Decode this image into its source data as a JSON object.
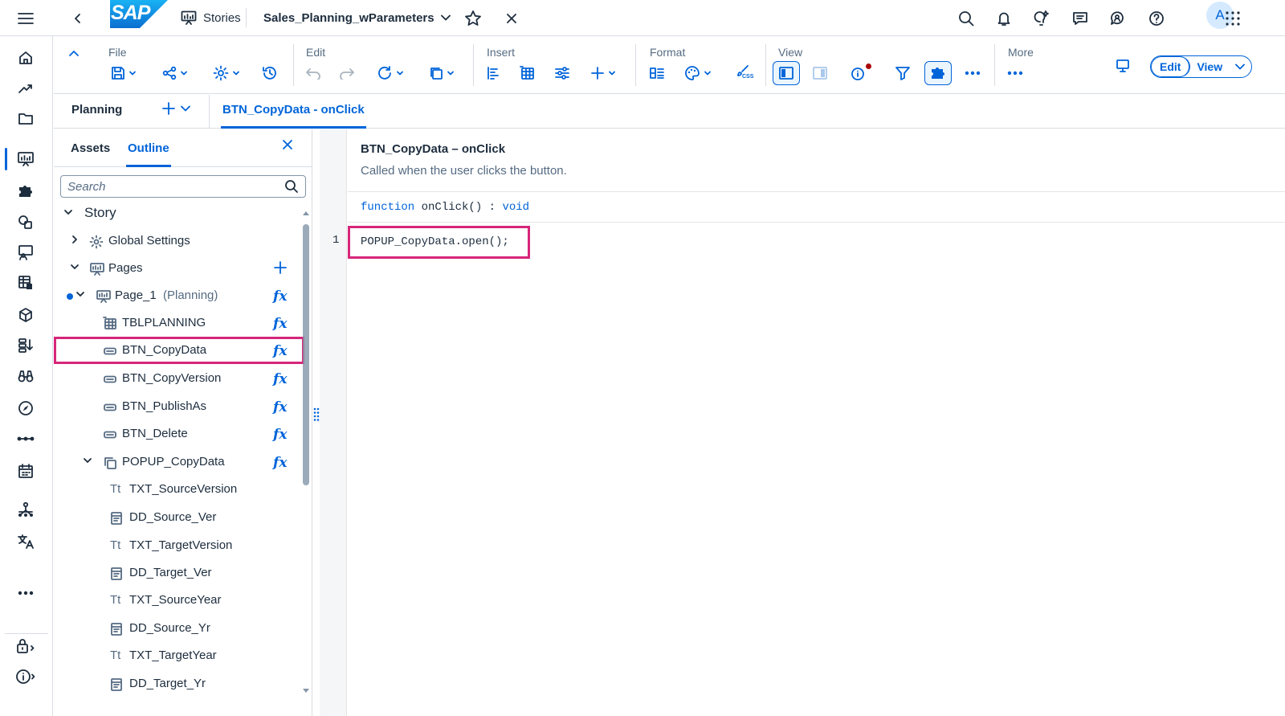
{
  "shell": {
    "logo_text": "SAP",
    "stories_label": "Stories",
    "story_title": "Sales_Planning_wParameters",
    "avatar_initial": "A",
    "accent_color": "#0064d9"
  },
  "left_nav": {
    "items": [
      "home-icon",
      "trend-icon",
      "folder-icon",
      "stories-icon",
      "plugin-icon",
      "analytic-app-icon",
      "presentation-icon",
      "dataset-icon",
      "model-cube-icon",
      "data-action-icon",
      "binoculars-icon",
      "compass-icon",
      "connector-icon",
      "calendar-icon",
      "hierarchy-icon",
      "translation-icon",
      "more-icon",
      "security-icon",
      "info-icon"
    ]
  },
  "toolbar": {
    "file_label": "File",
    "edit_label": "Edit",
    "insert_label": "Insert",
    "format_label": "Format",
    "view_label": "View",
    "more_label": "More",
    "edit_mode_label": "Edit",
    "view_mode_label": "View",
    "css_label": "CSS"
  },
  "tabs": {
    "page_label": "Planning",
    "script_tab_label": "BTN_CopyData - onClick"
  },
  "outline": {
    "assets_tab": "Assets",
    "outline_tab": "Outline",
    "search_placeholder": "Search",
    "tree": {
      "story": "Story",
      "global_settings": "Global Settings",
      "pages": "Pages",
      "page_1": "Page_1",
      "page_1_sub": "(Planning)",
      "tblplanning": "TBLPLANNING",
      "btn_copydata": "BTN_CopyData",
      "btn_copyversion": "BTN_CopyVersion",
      "btn_publishas": "BTN_PublishAs",
      "btn_delete": "BTN_Delete",
      "popup_copydata": "POPUP_CopyData",
      "txt_sourceversion": "TXT_SourceVersion",
      "dd_source_ver": "DD_Source_Ver",
      "txt_targetversion": "TXT_TargetVersion",
      "dd_target_ver": "DD_Target_Ver",
      "txt_sourceyear": "TXT_SourceYear",
      "dd_source_yr": "DD_Source_Yr",
      "txt_targetyear": "TXT_TargetYear",
      "dd_target_yr": "DD_Target_Yr"
    },
    "fx_label": "fx",
    "text_icon_label": "Tt"
  },
  "editor": {
    "event_title": "BTN_CopyData – onClick",
    "event_description": "Called when the user clicks the button.",
    "sig_keyword": "function",
    "sig_name": " onClick() : ",
    "sig_type": "void",
    "line_number": "1",
    "code": "POPUP_CopyData.open();",
    "highlight_color": "#d6267a"
  }
}
